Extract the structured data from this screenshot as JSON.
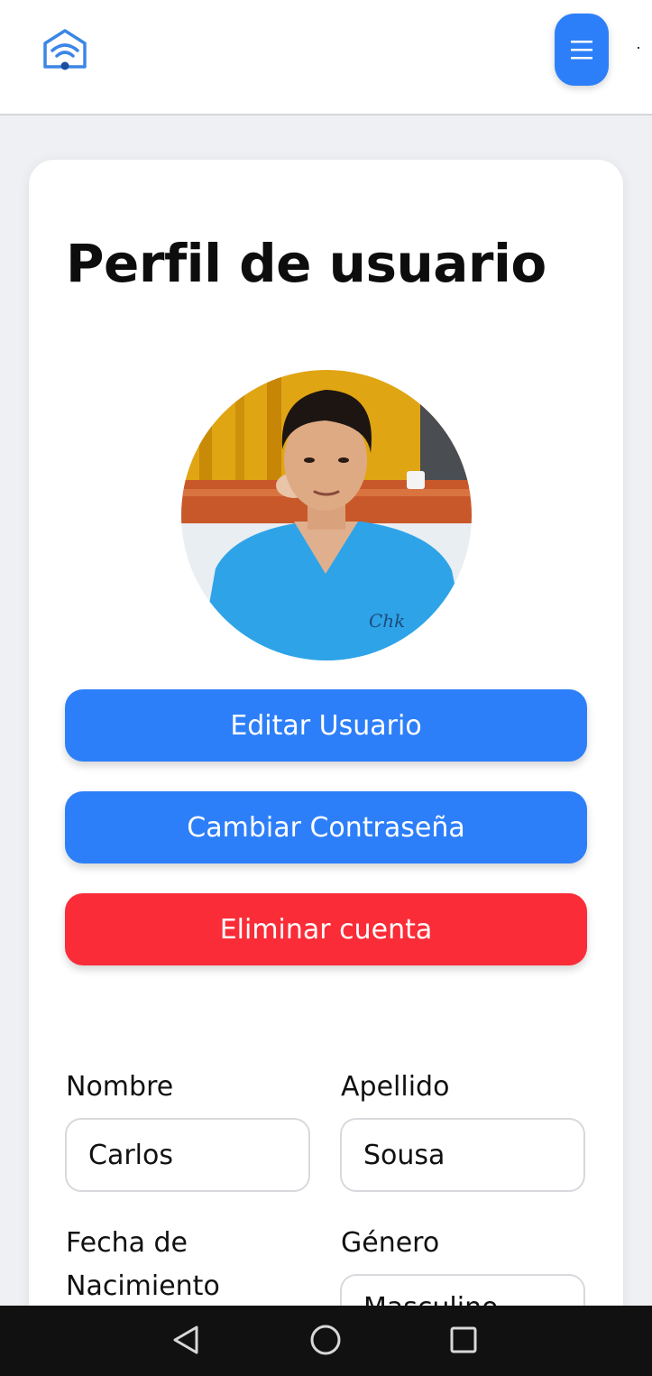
{
  "header": {
    "logo_icon": "wifi-house-icon",
    "menu_icon": "hamburger-menu-icon",
    "accent_color": "#2d7ff9"
  },
  "profile": {
    "title": "Perfil de usuario",
    "avatar": "profile-photo"
  },
  "actions": {
    "edit_label": "Editar Usuario",
    "password_label": "Cambiar Contraseña",
    "delete_label": "Eliminar cuenta",
    "delete_color": "#fa2c38"
  },
  "form": {
    "first_name_label": "Nombre",
    "first_name_value": "Carlos",
    "last_name_label": "Apellido",
    "last_name_value": "Sousa",
    "birthdate_label": "Fecha de Nacimiento",
    "gender_label": "Género",
    "gender_value": "Masculino"
  },
  "system_nav": {
    "back_icon": "back-triangle-icon",
    "home_icon": "home-circle-icon",
    "recents_icon": "recents-square-icon"
  }
}
